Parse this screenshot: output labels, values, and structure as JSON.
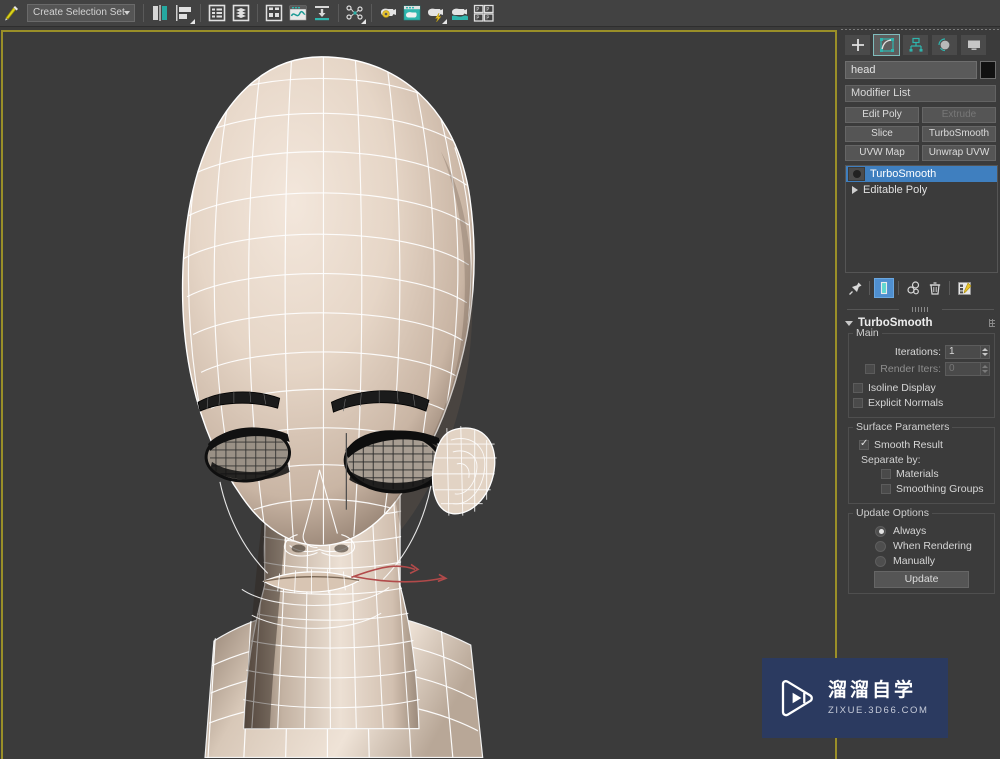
{
  "toolbar": {
    "selection_set": {
      "value": "Create Selection Set",
      "placeholder": "Create Selection Set"
    },
    "icons": [
      {
        "name": "named-selection-sets-icon",
        "label": "Named Selection Sets"
      },
      {
        "name": "mirror-icon",
        "label": "Mirror"
      },
      {
        "name": "align-icon",
        "label": "Align"
      },
      {
        "name": "layer-explorer-icon",
        "label": "Layer Explorer"
      },
      {
        "name": "manage-layers-icon",
        "label": "Manage Layers"
      },
      {
        "name": "compact-material-editor-icon",
        "label": "Compact Material Editor"
      },
      {
        "name": "curve-editor-icon",
        "label": "Curve Editor"
      },
      {
        "name": "render-setup-icon",
        "label": "Render Setup"
      },
      {
        "name": "schematic-view-icon",
        "label": "Schematic View"
      },
      {
        "name": "render-production-icon",
        "label": "Render Production"
      },
      {
        "name": "rendered-frame-window-icon",
        "label": "Rendered Frame Window"
      },
      {
        "name": "quick-render-icon",
        "label": "Quick Render"
      },
      {
        "name": "render-iterative-icon",
        "label": "Render Iterative"
      },
      {
        "name": "render-to-texture-icon",
        "label": "Render To Texture"
      }
    ]
  },
  "viewport": {
    "name": "perspective-viewport",
    "background_color": "#3b3b3b",
    "border_color": "#9a8f28",
    "model": "head mesh with TurboSmooth wireframe"
  },
  "command_panel": {
    "tabs": [
      {
        "name": "create-tab",
        "label": "Create",
        "icon": "plus-icon",
        "active": false
      },
      {
        "name": "modify-tab",
        "label": "Modify",
        "icon": "modify-icon",
        "active": true
      },
      {
        "name": "hierarchy-tab",
        "label": "Hierarchy",
        "icon": "hierarchy-icon",
        "active": false
      },
      {
        "name": "motion-tab",
        "label": "Motion",
        "icon": "motion-icon",
        "active": false
      },
      {
        "name": "display-tab",
        "label": "Display",
        "icon": "display-icon",
        "active": false
      }
    ],
    "object_name": "head",
    "object_name_placeholder": "head",
    "object_color": "#111111",
    "modifier_list_label": "Modifier List",
    "modifier_buttons": [
      [
        {
          "label": "Edit Poly",
          "disabled": false
        },
        {
          "label": "Extrude",
          "disabled": true
        }
      ],
      [
        {
          "label": "Slice",
          "disabled": false
        },
        {
          "label": "TurboSmooth",
          "disabled": false
        }
      ],
      [
        {
          "label": "UVW Map",
          "disabled": false
        },
        {
          "label": "Unwrap UVW",
          "disabled": false
        }
      ]
    ],
    "stack": [
      {
        "label": "TurboSmooth",
        "selected": true,
        "has_bulb": true,
        "has_arrow": false
      },
      {
        "label": "Editable Poly",
        "selected": false,
        "has_bulb": false,
        "has_arrow": true
      }
    ],
    "stack_tools": [
      {
        "name": "pin-stack-icon",
        "label": "Pin Stack",
        "active": false
      },
      {
        "name": "show-end-result-icon",
        "label": "Show End Result",
        "active": true
      },
      {
        "name": "make-unique-icon",
        "label": "Make Unique",
        "active": false
      },
      {
        "name": "remove-modifier-icon",
        "label": "Remove Modifier",
        "active": false
      },
      {
        "name": "configure-modifier-sets-icon",
        "label": "Configure Modifier Sets",
        "active": false
      }
    ],
    "rollout": {
      "title": "TurboSmooth",
      "main_group": {
        "title": "Main",
        "iterations": {
          "label": "Iterations:",
          "value": "1",
          "disabled": false
        },
        "render_iters": {
          "label": "Render Iters:",
          "value": "0",
          "checked": false,
          "disabled": true
        },
        "isoline_display": {
          "label": "Isoline Display",
          "checked": false
        },
        "explicit_normals": {
          "label": "Explicit Normals",
          "checked": false
        }
      },
      "surface_group": {
        "title": "Surface Parameters",
        "smooth_result": {
          "label": "Smooth Result",
          "checked": true
        },
        "separate_by_label": "Separate by:",
        "materials": {
          "label": "Materials",
          "checked": false
        },
        "smoothing_groups": {
          "label": "Smoothing Groups",
          "checked": false
        }
      },
      "update_group": {
        "title": "Update Options",
        "options": [
          {
            "label": "Always",
            "selected": true
          },
          {
            "label": "When Rendering",
            "selected": false
          },
          {
            "label": "Manually",
            "selected": false
          }
        ],
        "update_button": "Update"
      }
    }
  },
  "watermark": {
    "chinese": "溜溜自学",
    "english": "ZIXUE.3D66.COM",
    "background_color": "#2b3a60"
  }
}
